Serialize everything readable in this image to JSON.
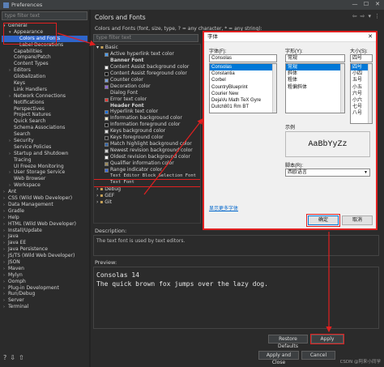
{
  "window": {
    "title": "Preferences",
    "controls": [
      "—",
      "☐",
      "✕"
    ]
  },
  "left": {
    "filter_placeholder": "type filter text",
    "tree": [
      {
        "label": "General",
        "level": 0,
        "twisty": "▾"
      },
      {
        "label": "Appearance",
        "level": 1,
        "twisty": "▾"
      },
      {
        "label": "Colors and Fonts",
        "level": 2,
        "twisty": "",
        "selected": true
      },
      {
        "label": "Label Decorations",
        "level": 2,
        "twisty": ""
      },
      {
        "label": "Capabilities",
        "level": 1,
        "twisty": ""
      },
      {
        "label": "Compare/Patch",
        "level": 1,
        "twisty": ""
      },
      {
        "label": "Content Types",
        "level": 1,
        "twisty": ""
      },
      {
        "label": "Editors",
        "level": 1,
        "twisty": "›"
      },
      {
        "label": "Globalization",
        "level": 1,
        "twisty": ""
      },
      {
        "label": "Keys",
        "level": 1,
        "twisty": ""
      },
      {
        "label": "Link Handlers",
        "level": 1,
        "twisty": ""
      },
      {
        "label": "Network Connections",
        "level": 1,
        "twisty": "›"
      },
      {
        "label": "Notifications",
        "level": 1,
        "twisty": ""
      },
      {
        "label": "Perspectives",
        "level": 1,
        "twisty": ""
      },
      {
        "label": "Project Natures",
        "level": 1,
        "twisty": ""
      },
      {
        "label": "Quick Search",
        "level": 1,
        "twisty": ""
      },
      {
        "label": "Schema Associations",
        "level": 1,
        "twisty": ""
      },
      {
        "label": "Search",
        "level": 1,
        "twisty": ""
      },
      {
        "label": "Security",
        "level": 1,
        "twisty": "›"
      },
      {
        "label": "Service Policies",
        "level": 1,
        "twisty": ""
      },
      {
        "label": "Startup and Shutdown",
        "level": 1,
        "twisty": "›"
      },
      {
        "label": "Tracing",
        "level": 1,
        "twisty": ""
      },
      {
        "label": "UI Freeze Monitoring",
        "level": 1,
        "twisty": ""
      },
      {
        "label": "User Storage Service",
        "level": 1,
        "twisty": "›"
      },
      {
        "label": "Web Browser",
        "level": 1,
        "twisty": ""
      },
      {
        "label": "Workspace",
        "level": 1,
        "twisty": "›"
      },
      {
        "label": "Ant",
        "level": 0,
        "twisty": "›"
      },
      {
        "label": "CSS (Wild Web Developer)",
        "level": 0,
        "twisty": "›"
      },
      {
        "label": "Data Management",
        "level": 0,
        "twisty": "›"
      },
      {
        "label": "Gradle",
        "level": 0,
        "twisty": "›"
      },
      {
        "label": "Help",
        "level": 0,
        "twisty": "›"
      },
      {
        "label": "HTML (Wild Web Developer)",
        "level": 0,
        "twisty": "›"
      },
      {
        "label": "Install/Update",
        "level": 0,
        "twisty": "›"
      },
      {
        "label": "Java",
        "level": 0,
        "twisty": "›"
      },
      {
        "label": "Java EE",
        "level": 0,
        "twisty": "›"
      },
      {
        "label": "Java Persistence",
        "level": 0,
        "twisty": "›"
      },
      {
        "label": "JS/TS (Wild Web Developer)",
        "level": 0,
        "twisty": "›"
      },
      {
        "label": "JSON",
        "level": 0,
        "twisty": "›"
      },
      {
        "label": "Maven",
        "level": 0,
        "twisty": "›"
      },
      {
        "label": "Mylyn",
        "level": 0,
        "twisty": "›"
      },
      {
        "label": "Oomph",
        "level": 0,
        "twisty": "›"
      },
      {
        "label": "Plug-in Development",
        "level": 0,
        "twisty": "›"
      },
      {
        "label": "Run/Debug",
        "level": 0,
        "twisty": "›"
      },
      {
        "label": "Server",
        "level": 0,
        "twisty": "›"
      },
      {
        "label": "Terminal",
        "level": 0,
        "twisty": "›"
      }
    ]
  },
  "right": {
    "title": "Colors and Fonts",
    "nav_icons": [
      "⇦",
      "⇨",
      "▾",
      "⋮"
    ],
    "description": "Colors and Fonts (font, size, type, ? = any character, * = any string):",
    "filter_placeholder": "type filter text",
    "categories": [
      {
        "label": "Basic",
        "twisty": "▾",
        "items": [
          {
            "label": "Active hyperlink text color",
            "color": "#4a9cf0"
          },
          {
            "label": "Banner Font",
            "font": true,
            "style": "bold"
          },
          {
            "label": "Content Assist background color",
            "color": "#ffffff"
          },
          {
            "label": "Content Assist foreground color",
            "color": "#000000"
          },
          {
            "label": "Counter color",
            "color": "#7a9fdc"
          },
          {
            "label": "Decoration color",
            "color": "#8f6ad8"
          },
          {
            "label": "Dialog Font",
            "font": true
          },
          {
            "label": "Error text color",
            "color": "#e53935"
          },
          {
            "label": "Header Font",
            "font": true,
            "style": "bold"
          },
          {
            "label": "Hyperlink text color",
            "color": "#1e6fd9"
          },
          {
            "label": "Information background color",
            "color": "#f5f0d0"
          },
          {
            "label": "Information foreground color",
            "color": "#111111"
          },
          {
            "label": "Keys background color",
            "color": "#dddddd"
          },
          {
            "label": "Keys foreground color",
            "color": "#222222"
          },
          {
            "label": "Match highlight background color",
            "color": "#3366aa"
          },
          {
            "label": "Newest revision background color",
            "color": "#cfcfcf"
          },
          {
            "label": "Oldest revision background color",
            "color": "#ffffff"
          },
          {
            "label": "Qualifier information color",
            "color": "#9c8a5a"
          },
          {
            "label": "Range indicator color",
            "color": "#3d6ad9"
          },
          {
            "label": "Text Editor Block Selection Font",
            "font": true,
            "style": "mono"
          },
          {
            "label": "Text Font",
            "font": true,
            "style": "mono",
            "selected": true
          }
        ]
      },
      {
        "label": "Debug",
        "twisty": "›",
        "items": []
      },
      {
        "label": "GEF",
        "twisty": "›",
        "items": []
      },
      {
        "label": "Git",
        "twisty": "›",
        "items": []
      }
    ],
    "description_label": "Description:",
    "description_text": "The text font is used by text editors.",
    "preview_label": "Preview:",
    "preview_lines": [
      "Consolas 14",
      "The quick brown fox jumps over the lazy dog."
    ],
    "restore_defaults": "Restore Defaults",
    "apply": "Apply"
  },
  "bottom": {
    "apply_close": "Apply and Close",
    "cancel": "Cancel",
    "icons": [
      "?",
      "⇩",
      "⇧"
    ],
    "watermark": "CSDN @阿来小同学"
  },
  "font_dialog": {
    "title": "字体",
    "close": "✕",
    "font_label": "字体(F):",
    "font_value": "Consolas",
    "font_list": [
      "Consolas",
      "Constantia",
      "Corbel",
      "CountryBlueprint",
      "Courier New",
      "DejaVu Math TeX Gyre",
      "Dutch801 Rm BT"
    ],
    "font_selected": "Consolas",
    "style_label": "字形(Y):",
    "style_value": "常规",
    "style_list": [
      "常规",
      "斜体",
      "粗体",
      "粗偏斜体"
    ],
    "style_selected": "常规",
    "size_label": "大小(S):",
    "size_value": "四号",
    "size_list": [
      "四号",
      "小四",
      "五号",
      "小五",
      "六号",
      "小六",
      "七号",
      "八号"
    ],
    "size_selected": "四号",
    "sample_label": "示例",
    "sample_text": "AaBbYyZz",
    "script_label": "脚本(R):",
    "script_value": "西欧语言",
    "more_fonts": "显示更多字体",
    "ok": "确定",
    "cancel": "取消"
  },
  "annotation_color": "#e02020"
}
